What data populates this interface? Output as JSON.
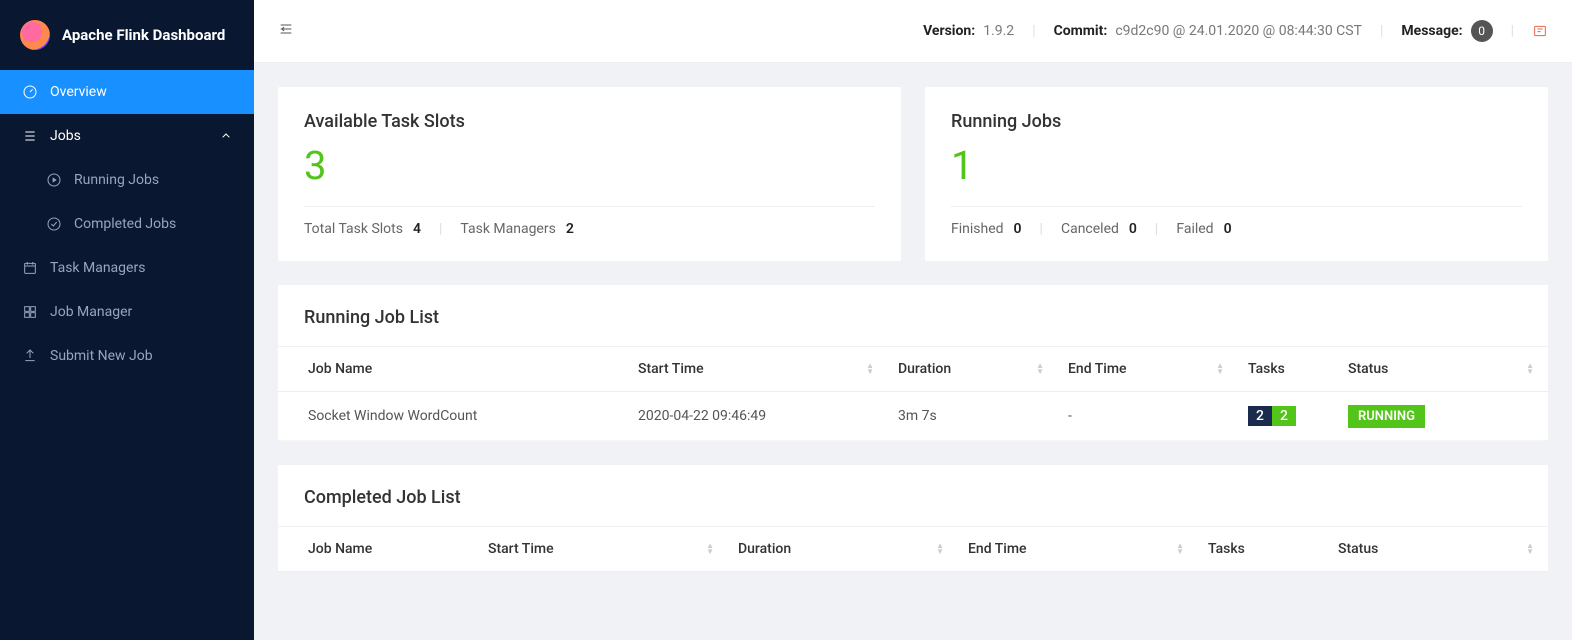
{
  "app": {
    "title": "Apache Flink Dashboard"
  },
  "sidebar": {
    "overview": "Overview",
    "jobs": "Jobs",
    "running_jobs": "Running Jobs",
    "completed_jobs": "Completed Jobs",
    "task_managers": "Task Managers",
    "job_manager": "Job Manager",
    "submit_new_job": "Submit New Job"
  },
  "header": {
    "version_label": "Version:",
    "version_value": "1.9.2",
    "commit_label": "Commit:",
    "commit_value": "c9d2c90 @ 24.01.2020 @ 08:44:30 CST",
    "message_label": "Message:",
    "message_count": "0"
  },
  "cards": {
    "slots": {
      "title": "Available Task Slots",
      "value": "3",
      "total_label": "Total Task Slots",
      "total_value": "4",
      "managers_label": "Task Managers",
      "managers_value": "2"
    },
    "jobs": {
      "title": "Running Jobs",
      "value": "1",
      "finished_label": "Finished",
      "finished_value": "0",
      "canceled_label": "Canceled",
      "canceled_value": "0",
      "failed_label": "Failed",
      "failed_value": "0"
    }
  },
  "running_list": {
    "title": "Running Job List",
    "columns": {
      "name": "Job Name",
      "start": "Start Time",
      "duration": "Duration",
      "end": "End Time",
      "tasks": "Tasks",
      "status": "Status"
    },
    "row": {
      "name": "Socket Window WordCount",
      "start": "2020-04-22 09:46:49",
      "duration": "3m 7s",
      "end": "-",
      "tasks_a": "2",
      "tasks_b": "2",
      "status": "RUNNING"
    }
  },
  "completed_list": {
    "title": "Completed Job List",
    "columns": {
      "name": "Job Name",
      "start": "Start Time",
      "duration": "Duration",
      "end": "End Time",
      "tasks": "Tasks",
      "status": "Status"
    }
  }
}
